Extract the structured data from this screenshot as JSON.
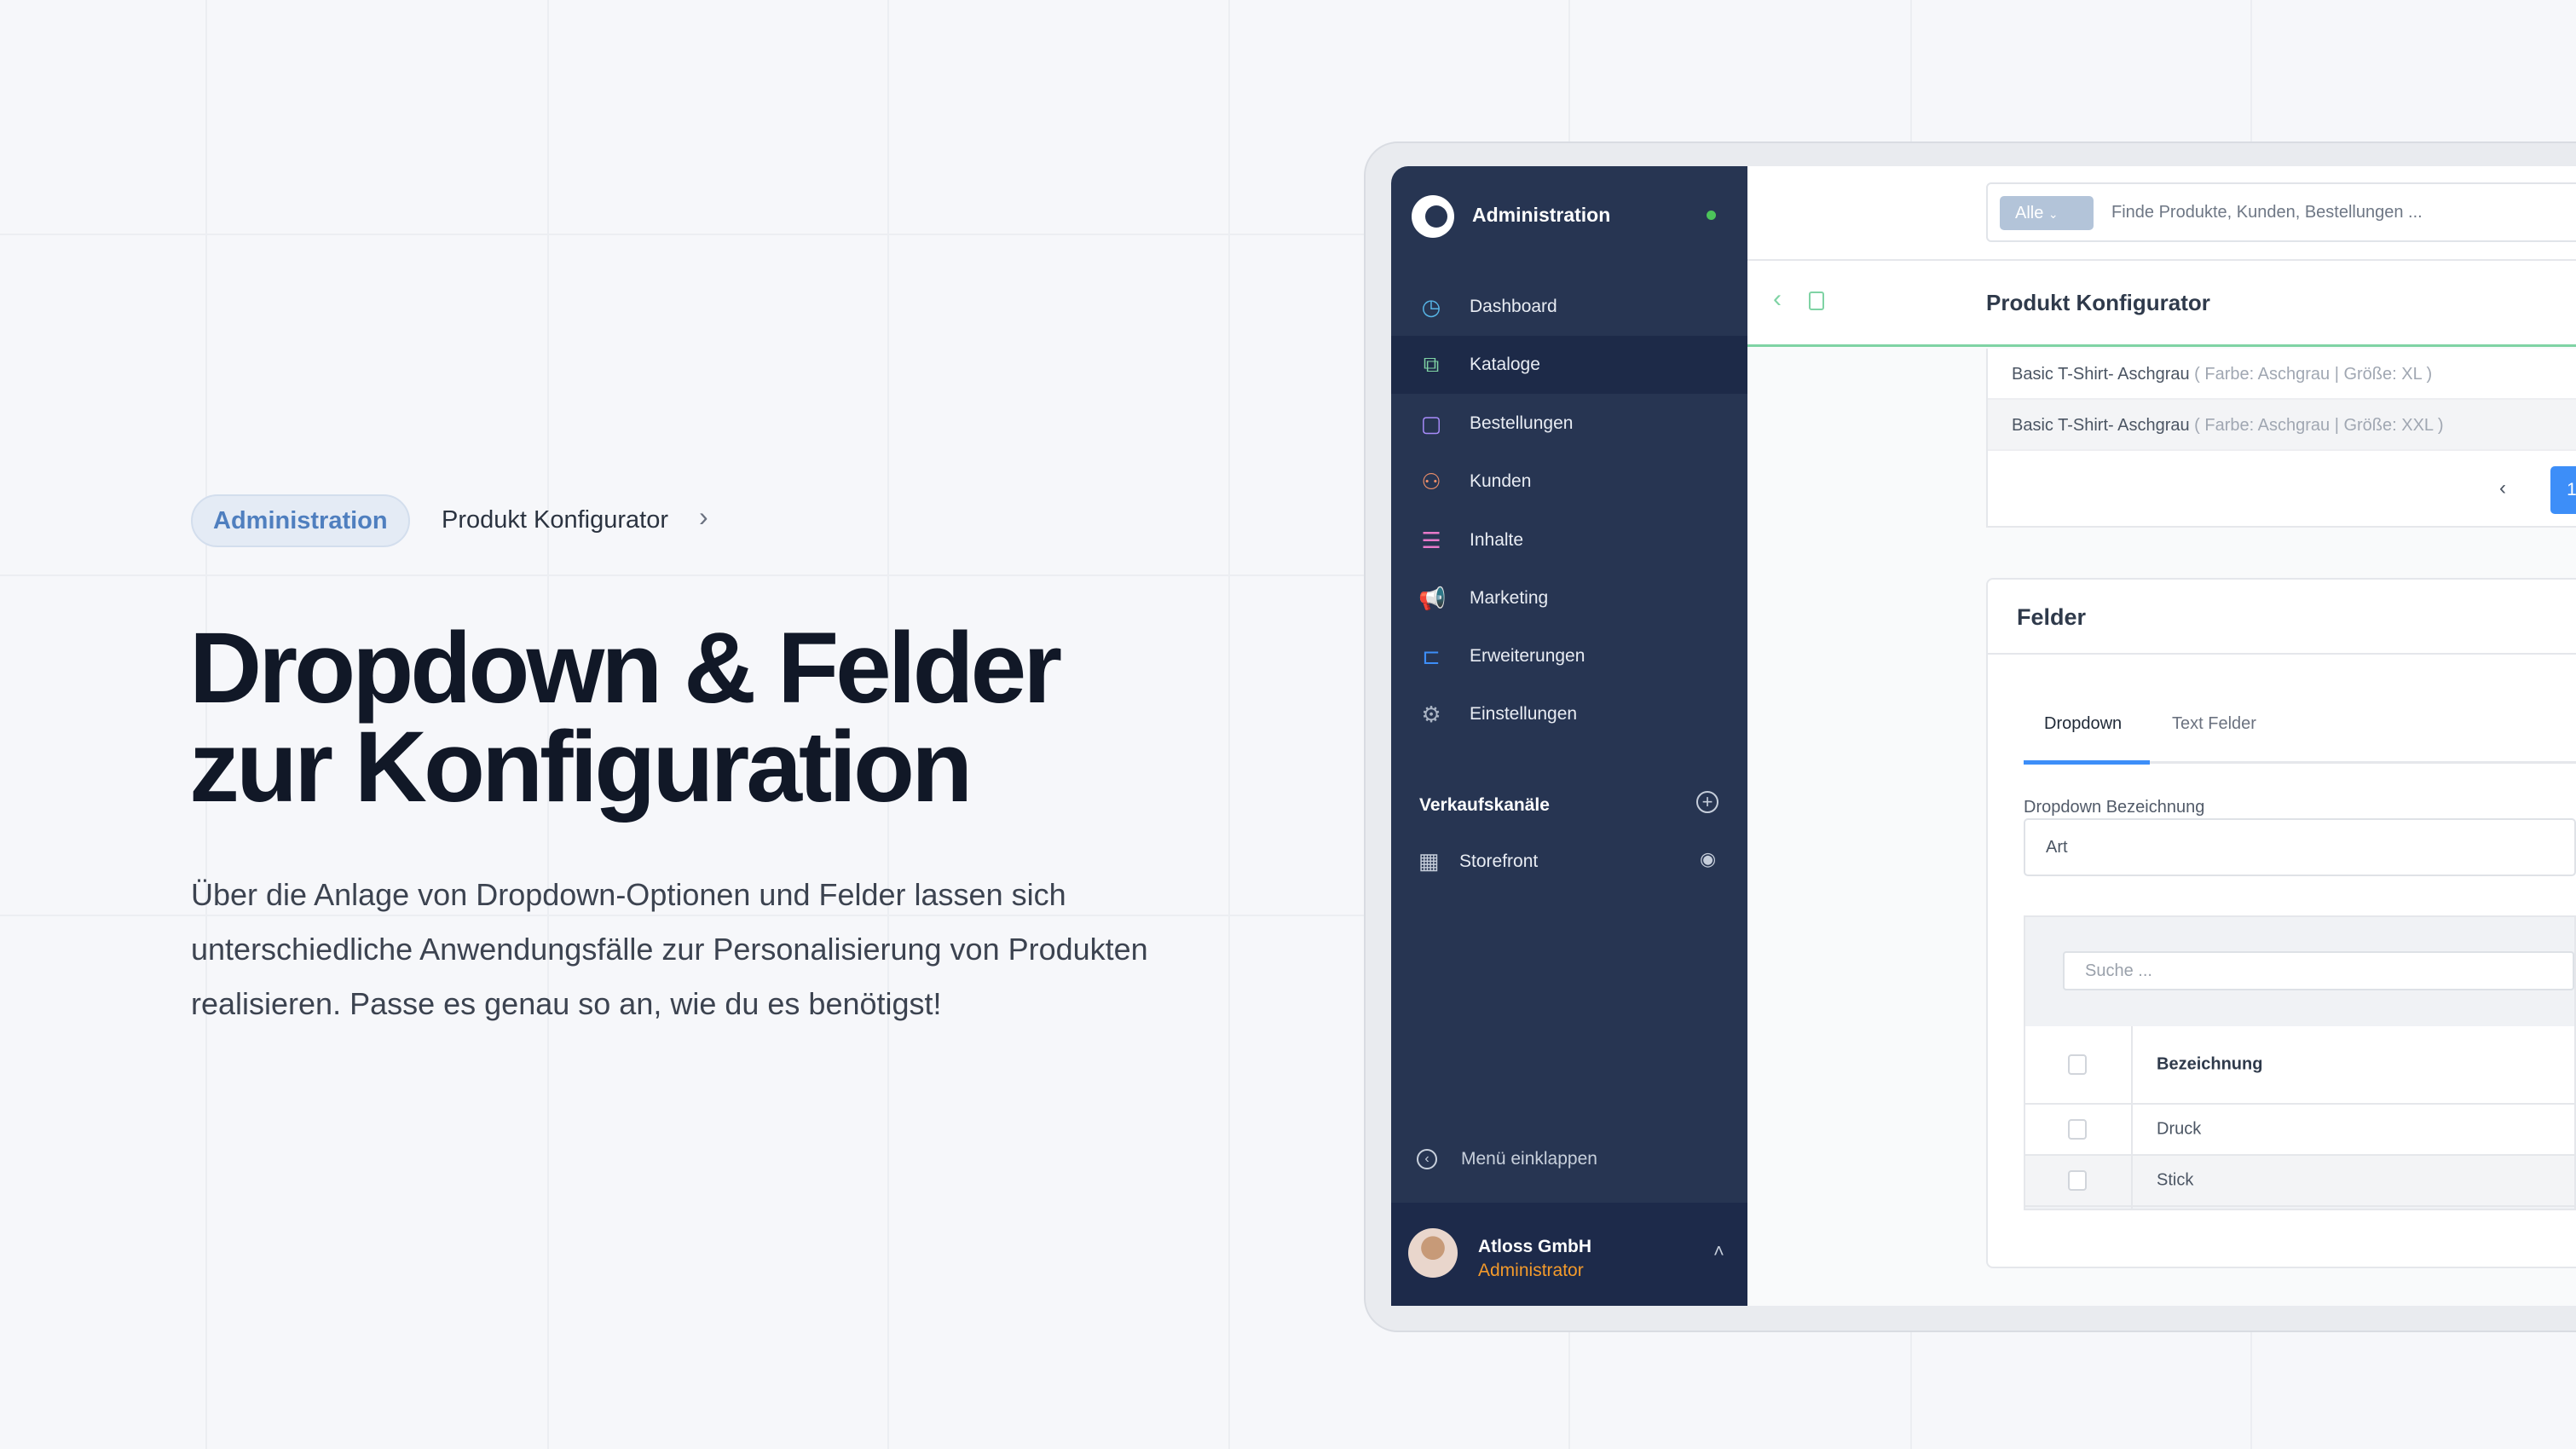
{
  "hero": {
    "breadcrumb": {
      "pill": "Administration",
      "current": "Produkt Konfigurator",
      "chevron": "›"
    },
    "title_line1": "Dropdown & Felder",
    "title_line2": "zur Konfiguration",
    "description": "Über die Anlage von Dropdown-Optionen und Felder lassen sich unterschiedliche Anwendungsfälle zur Personalisierung von Produkten realisieren. Passe es genau so an, wie du es benötigst!"
  },
  "sidebar": {
    "title": "Administration",
    "status_color": "#4cc35a",
    "items": [
      {
        "label": "Dashboard",
        "icon": "gauge-icon",
        "glyph": "◷",
        "color": "#57b5e6"
      },
      {
        "label": "Kataloge",
        "icon": "catalog-icon",
        "glyph": "⧉",
        "color": "#7fd3a4",
        "active": true
      },
      {
        "label": "Bestellungen",
        "icon": "shopping-bag-icon",
        "glyph": "▢",
        "color": "#a78bfa"
      },
      {
        "label": "Kunden",
        "icon": "users-icon",
        "glyph": "⚇",
        "color": "#f0906a"
      },
      {
        "label": "Inhalte",
        "icon": "content-icon",
        "glyph": "☰",
        "color": "#e879c9"
      },
      {
        "label": "Marketing",
        "icon": "megaphone-icon",
        "glyph": "📢",
        "color": "#f5c543"
      },
      {
        "label": "Erweiterungen",
        "icon": "plugin-icon",
        "glyph": "⊏",
        "color": "#3d8ef8"
      },
      {
        "label": "Einstellungen",
        "icon": "gear-icon",
        "glyph": "⚙",
        "color": "#aab4c4"
      }
    ],
    "section": "Verkaufskanäle",
    "channel": "Storefront",
    "collapse": "Menü einklappen",
    "user": {
      "name": "Atloss GmbH",
      "role": "Administrator"
    }
  },
  "topbar": {
    "filter": "Alle",
    "placeholder": "Finde Produkte, Kunden, Bestellungen ..."
  },
  "page": {
    "title": "Produkt Konfigurator"
  },
  "variants": [
    {
      "name": "Basic T-Shirt- Aschgrau",
      "meta": " ( Farbe: Aschgrau | Größe: XL )"
    },
    {
      "name": "Basic T-Shirt- Aschgrau",
      "meta": " ( Farbe: Aschgrau | Größe: XXL )"
    }
  ],
  "pagination": {
    "prev": "‹",
    "current": "1"
  },
  "felder": {
    "title": "Felder",
    "tabs": [
      "Dropdown",
      "Text Felder"
    ],
    "label": "Dropdown Bezeichnung",
    "value": "Art",
    "search_placeholder": "Suche ...",
    "column": "Bezeichnung",
    "rows": [
      "Druck",
      "Stick"
    ]
  },
  "colors": {
    "sidebar": "#273552",
    "accent": "#3d8ef8",
    "green": "#7fd3a4",
    "role": "#f39a2b"
  }
}
